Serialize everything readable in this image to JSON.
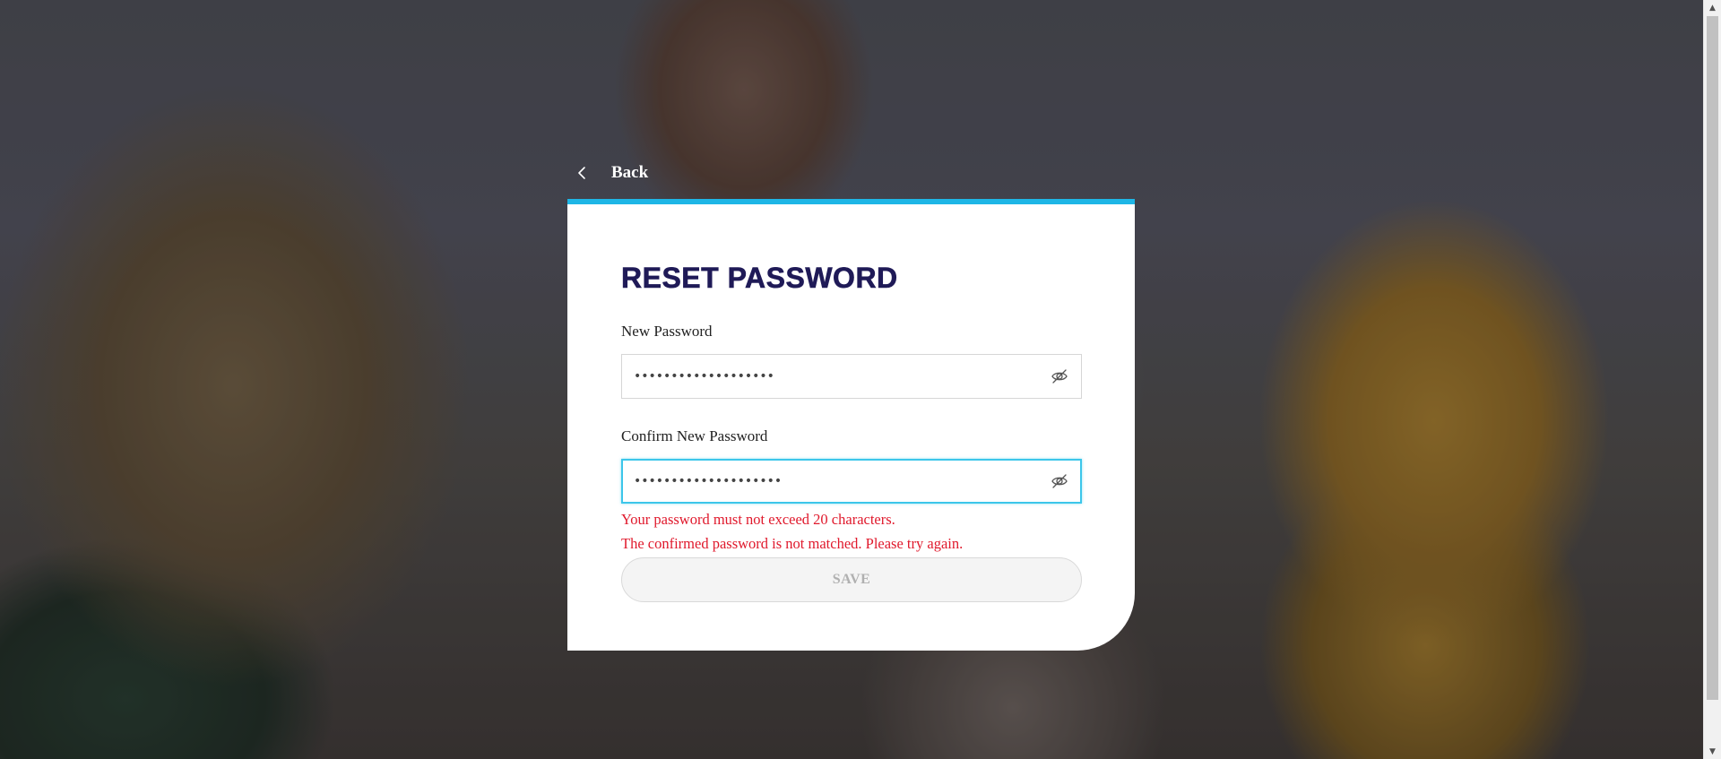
{
  "background": {
    "description_icon": "photo-background",
    "overlay_color": "#14141c"
  },
  "colors": {
    "accent": "#1eb6e6",
    "title": "#1f1a57",
    "error": "#e0192c",
    "button_disabled_text": "#b0b0b0"
  },
  "nav": {
    "back_icon": "chevron-left-icon",
    "back_label": "Back"
  },
  "card": {
    "title": "RESET PASSWORD",
    "new_password": {
      "label": "New Password",
      "value": "•••••••••••••••••••",
      "toggle_icon": "eye-off-icon"
    },
    "confirm_password": {
      "label": "Confirm New Password",
      "value": "••••••••••••••••••••",
      "toggle_icon": "eye-off-icon",
      "state": "focused"
    },
    "errors": [
      "Your password must not exceed 20 characters.",
      "The confirmed password is not matched. Please try again."
    ],
    "save_label": "SAVE",
    "save_state": "disabled"
  }
}
